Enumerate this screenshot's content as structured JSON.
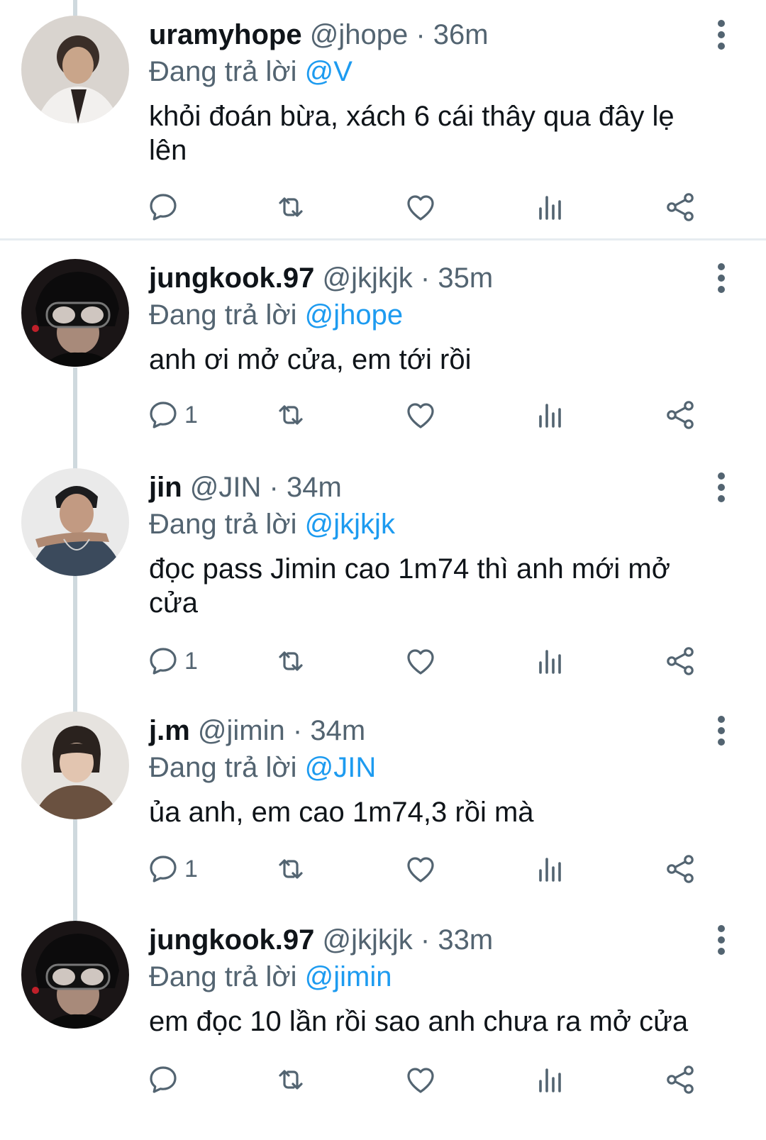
{
  "reply_prefix": "Đang trả lời",
  "tweets": [
    {
      "name": "uramyhope",
      "handle": "@jhope",
      "time": "· 36m",
      "reply_to": "@V",
      "text": "khỏi đoán bừa, xách 6 cái thây qua đây lẹ lên",
      "reply_count": ""
    },
    {
      "name": "jungkook.97",
      "handle": "@jkjkjk",
      "time": "· 35m",
      "reply_to": "@jhope",
      "text": "anh ơi mở cửa, em tới rồi",
      "reply_count": "1"
    },
    {
      "name": "jin",
      "handle": "@JIN",
      "time": "· 34m",
      "reply_to": "@jkjkjk",
      "text": "đọc pass Jimin cao 1m74 thì anh mới mở cửa",
      "reply_count": "1"
    },
    {
      "name": "j.m",
      "handle": "@jimin",
      "time": "· 34m",
      "reply_to": "@JIN",
      "text": "ủa anh, em cao 1m74,3 rồi mà",
      "reply_count": "1"
    },
    {
      "name": "jungkook.97",
      "handle": "@jkjkjk",
      "time": "· 33m",
      "reply_to": "@jimin",
      "text": "em đọc 10 lần rồi sao anh chưa ra mở cửa",
      "reply_count": ""
    }
  ],
  "icons": {
    "reply": "reply-icon",
    "retweet": "retweet-icon",
    "like": "heart-icon",
    "views": "views-icon",
    "share": "share-icon",
    "more": "more-vertical-icon"
  },
  "colors": {
    "name": "#0f1419",
    "secondary": "#536471",
    "mention": "#1d9bf0",
    "thread_line": "#cfd9de",
    "divider": "#e6ecf0"
  }
}
